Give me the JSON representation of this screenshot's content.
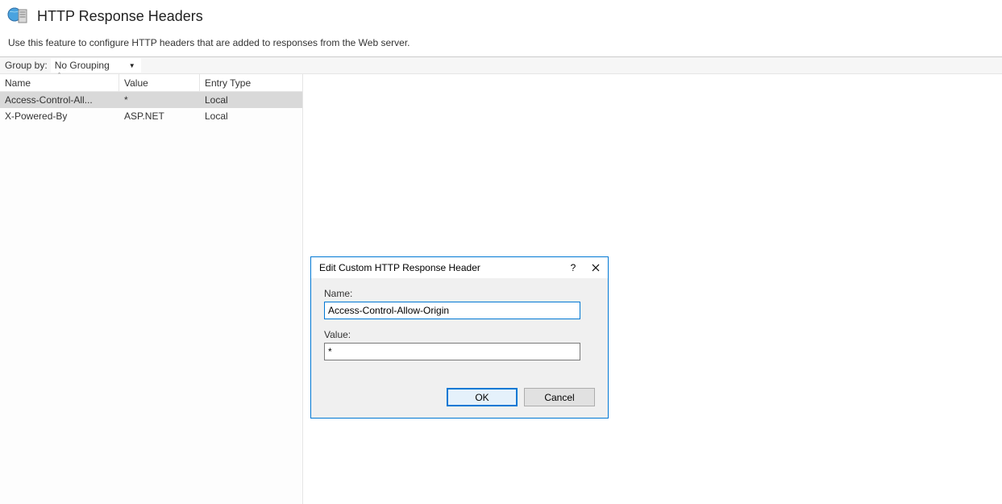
{
  "page": {
    "title": "HTTP Response Headers",
    "description": "Use this feature to configure HTTP headers that are added to responses from the Web server."
  },
  "toolbar": {
    "group_by_label": "Group by:",
    "group_by_value": "No Grouping"
  },
  "grid": {
    "columns": {
      "name": "Name",
      "value": "Value",
      "entry_type": "Entry Type"
    },
    "rows": [
      {
        "name": "Access-Control-All...",
        "value": "*",
        "entry_type": "Local",
        "selected": true
      },
      {
        "name": "X-Powered-By",
        "value": "ASP.NET",
        "entry_type": "Local",
        "selected": false
      }
    ]
  },
  "dialog": {
    "title": "Edit Custom HTTP Response Header",
    "help_glyph": "?",
    "close_glyph": "✕",
    "name_label": "Name:",
    "name_value": "Access-Control-Allow-Origin",
    "value_label": "Value:",
    "value_value": "*",
    "ok_label": "OK",
    "cancel_label": "Cancel"
  }
}
